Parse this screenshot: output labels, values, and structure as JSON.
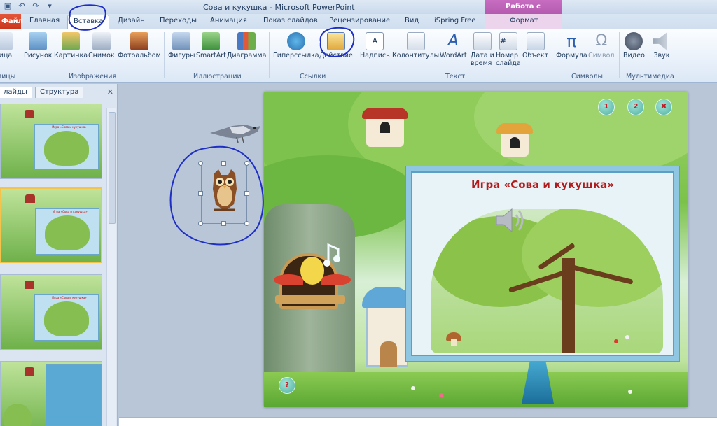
{
  "window": {
    "title": "Сова и кукушка  -  Microsoft PowerPoint",
    "context_header": "Работа с рисунками"
  },
  "tabs": {
    "file": "Файл",
    "home": "Главная",
    "insert": "Вставка",
    "design": "Дизайн",
    "transitions": "Переходы",
    "animation": "Анимация",
    "slideshow": "Показ слайдов",
    "review": "Рецензирование",
    "view": "Вид",
    "ispring": "iSpring Free",
    "format": "Формат"
  },
  "ribbon": {
    "table": "лица",
    "picture": "Рисунок",
    "clipart": "Картинка",
    "screenshot": "Снимок",
    "photoalbum": "Фотоальбом",
    "shapes": "Фигуры",
    "smartart": "SmartArt",
    "chart": "Диаграмма",
    "hyperlink": "Гиперссылка",
    "action": "Действие",
    "textbox": "Надпись",
    "headerfooter": "Колонтитулы",
    "wordart": "WordArt",
    "datetime_1": "Дата и",
    "datetime_2": "время",
    "slidenumber_1": "Номер",
    "slidenumber_2": "слайда",
    "object": "Объект",
    "equation": "Формула",
    "symbol": "Символ",
    "video": "Видео",
    "audio": "Звук",
    "group_tables": "лицы",
    "group_images": "Изображения",
    "group_illustrations": "Иллюстрации",
    "group_links": "Ссылки",
    "group_text": "Текст",
    "group_symbols": "Символы",
    "group_media": "Мультимедиа"
  },
  "leftpane": {
    "tab_slides": "лайды",
    "tab_outline": "Структура",
    "close": "✕",
    "thumb_title": "Игра «Сова и кукушка»"
  },
  "slide": {
    "panel_title": "Игра «Сова и кукушка»",
    "nav_1": "1",
    "nav_2": "2",
    "nav_close": "✖",
    "help": "?"
  },
  "icons": {
    "app": "powerpoint-icon",
    "save": "save-icon",
    "undo": "undo-icon",
    "redo": "redo-icon"
  },
  "colors": {
    "file_tab": "#d4431f",
    "context_tab": "#b35bb0",
    "panel_title": "#b21b1b",
    "annotation": "#1f2fc4",
    "selection": "#7a90ad"
  }
}
